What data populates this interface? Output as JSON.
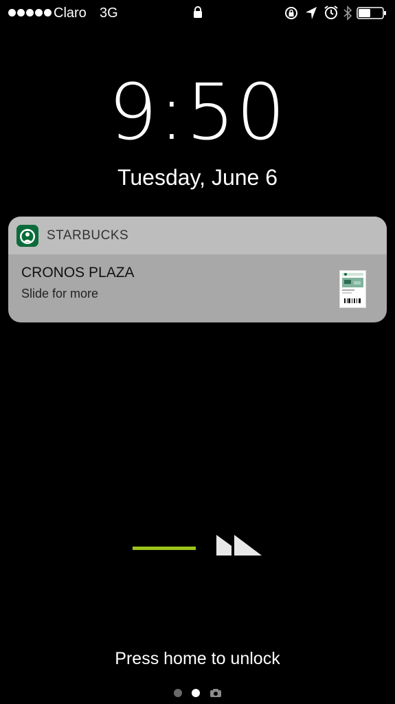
{
  "status_bar": {
    "carrier": "Claro",
    "network": "3G",
    "signal_bars": 5,
    "battery_level": 0.5,
    "icons": [
      "lock-icon",
      "rotation-lock-icon",
      "location-icon",
      "alarm-icon",
      "bluetooth-icon",
      "battery-icon"
    ]
  },
  "lock_screen": {
    "time": "9:50",
    "date": "Tuesday, June 6",
    "unlock_hint": "Press home to unlock"
  },
  "notification": {
    "app_name": "STARBUCKS",
    "title": "CRONOS PLAZA",
    "subtitle": "Slide for more"
  },
  "colors": {
    "background": "#000000",
    "swipe_accent": "#9cc41a",
    "starbucks_green": "#0b6b3a"
  },
  "page_indicator": {
    "pages": 3,
    "active_index": 1,
    "last_page_icon": "camera-icon"
  }
}
